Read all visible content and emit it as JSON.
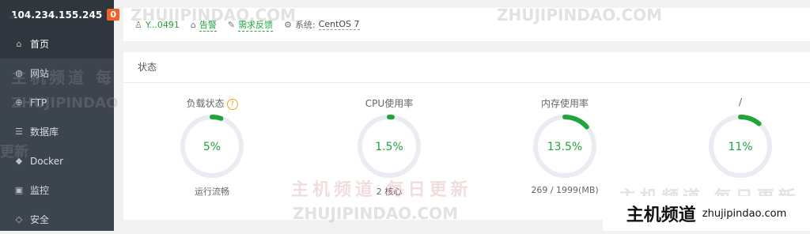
{
  "sidebar": {
    "ip": "104.234.155.245",
    "badge": "0",
    "items": [
      {
        "label": "首页",
        "icon": "home-icon",
        "glyph": "⌂"
      },
      {
        "label": "网站",
        "icon": "globe-icon",
        "glyph": "◍"
      },
      {
        "label": "FTP",
        "icon": "ftp-icon",
        "glyph": "⊕"
      },
      {
        "label": "数据库",
        "icon": "database-icon",
        "glyph": "☰"
      },
      {
        "label": "Docker",
        "icon": "docker-icon",
        "glyph": "◆"
      },
      {
        "label": "监控",
        "icon": "monitor-icon",
        "glyph": "▣"
      },
      {
        "label": "安全",
        "icon": "shield-icon",
        "glyph": "◇"
      }
    ]
  },
  "top": {
    "user": "Y...0491",
    "alarm": "告警",
    "feedback": "需求反馈",
    "system_label": "系统:",
    "system_value": "CentOS 7"
  },
  "status": {
    "title": "状态",
    "help_glyph": "?",
    "gauges": [
      {
        "label": "负载状态",
        "value": "5%",
        "percent": 5,
        "footer": "运行流畅",
        "help": true
      },
      {
        "label": "CPU使用率",
        "value": "1.5%",
        "percent": 1.5,
        "footer": "2 核心"
      },
      {
        "label": "内存使用率",
        "value": "13.5%",
        "percent": 13.5,
        "footer": "269 / 1999(MB)"
      },
      {
        "label": "/",
        "value": "11%",
        "percent": 11,
        "footer": ""
      }
    ]
  },
  "watermark": {
    "latin": "ZHUJIPINDAO.COM",
    "cn": "主机频道 每日更新",
    "cn_fragment": "主机频道 每",
    "en_fragment": "ZHUJIPINDAO",
    "cn_edge": "更新"
  },
  "brand": {
    "cn": "主机频道",
    "url": "zhujipindao.com"
  },
  "colors": {
    "accent": "#20a53a",
    "track": "#e9edf2",
    "sidebar": "#3c444d",
    "badge": "#f0642b"
  }
}
